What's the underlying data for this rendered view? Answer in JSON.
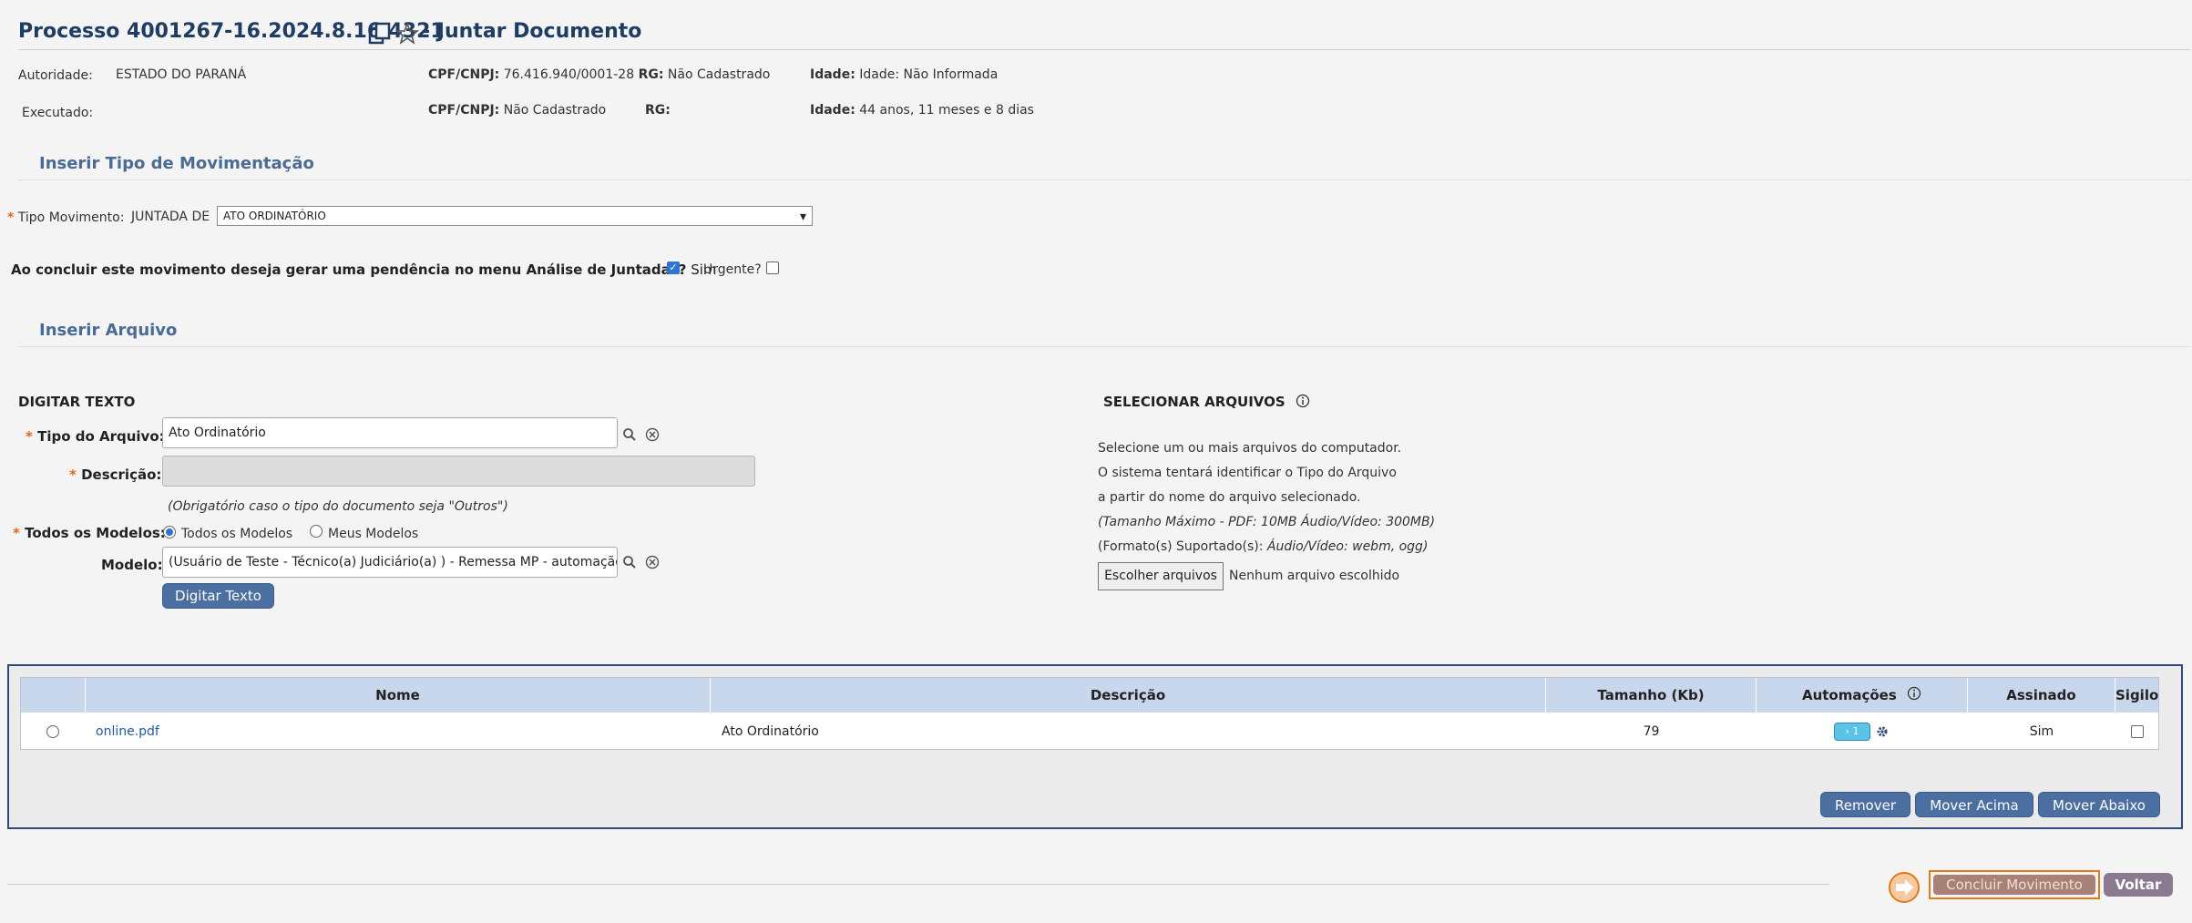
{
  "header": {
    "title": "Processo 4001267-16.2024.8.16.4321",
    "title_suffix": "- Juntar Documento",
    "copy_icon": "copy-icon",
    "star_icon": "star-icon"
  },
  "parties": {
    "autoridade_label": "Autoridade:",
    "autoridade_value": "ESTADO DO PARANÁ",
    "autoridade_cpf_label": "CPF/CNPJ:",
    "autoridade_cpf_value": "76.416.940/0001-28",
    "autoridade_rg_label": "RG:",
    "autoridade_rg_value": "Não Cadastrado",
    "autoridade_idade_label": "Idade:",
    "autoridade_idade_value": "Idade: Não Informada",
    "executado_label": "Executado:",
    "executado_cpf_label": "CPF/CNPJ:",
    "executado_cpf_value": "Não Cadastrado",
    "executado_rg_label": "RG:",
    "executado_idade_label": "Idade:",
    "executado_idade_value": "44 anos, 11 meses e 8 dias"
  },
  "mov": {
    "section_title": "Inserir Tipo de Movimentação",
    "tipo_label": "Tipo Movimento:",
    "tipo_prefix": "JUNTADA DE",
    "tipo_value": "ATO ORDINATÓRIO",
    "pendencia_question": "Ao concluir este movimento deseja gerar uma pendência no menu Análise de Juntadas?",
    "sim_label": "Sim",
    "urgente_label": "Urgente?"
  },
  "arquivo": {
    "section_title": "Inserir Arquivo",
    "digitar_title": "DIGITAR TEXTO",
    "tipo_arquivo_label": "Tipo do Arquivo:",
    "tipo_arquivo_value": "Ato Ordinatório",
    "descricao_label": "Descrição:",
    "descricao_hint": "(Obrigatório caso o tipo do documento seja \"Outros\")",
    "todos_modelos_label": "Todos os Modelos:",
    "radio_todos": "Todos os Modelos",
    "radio_meus": "Meus Modelos",
    "modelo_label": "Modelo:",
    "modelo_value": "(Usuário de Teste - Técnico(a) Judiciário(a) ) - Remessa MP - automação",
    "digitar_button": "Digitar Texto",
    "selecionar_title": "SELECIONAR ARQUIVOS",
    "sel_line1": "Selecione um ou mais arquivos do computador.",
    "sel_line2": "O sistema tentará identificar o Tipo do Arquivo",
    "sel_line3": "a partir do nome do arquivo selecionado.",
    "sel_line4": "(Tamanho Máximo - PDF: 10MB  Áudio/Vídeo: 300MB)",
    "sel_line5_prefix": "(Formato(s) Suportado(s):",
    "sel_line5_value": "Áudio/Vídeo: webm, ogg)",
    "escolher_button": "Escolher arquivos",
    "nenhum_arquivo": "Nenhum arquivo escolhido"
  },
  "table": {
    "headers": [
      "Nome",
      "Descrição",
      "Tamanho (Kb)",
      "Automações",
      "Assinado",
      "Sigilo"
    ],
    "rows": [
      {
        "nome": "online.pdf",
        "descricao": "Ato Ordinatório",
        "tamanho": "79",
        "automacoes": "1",
        "assinado": "Sim"
      }
    ],
    "remover": "Remover",
    "mover_acima": "Mover Acima",
    "mover_abaixo": "Mover Abaixo"
  },
  "footer": {
    "concluir": "Concluir Movimento",
    "voltar": "Voltar"
  },
  "colors": {
    "title": "#1f3c63",
    "section": "#4a6b94",
    "button": "#4b6fa0",
    "concluir_bg": "#a88276",
    "concluir_border": "#e07a1a",
    "voltar_bg": "#8b7a8f"
  }
}
